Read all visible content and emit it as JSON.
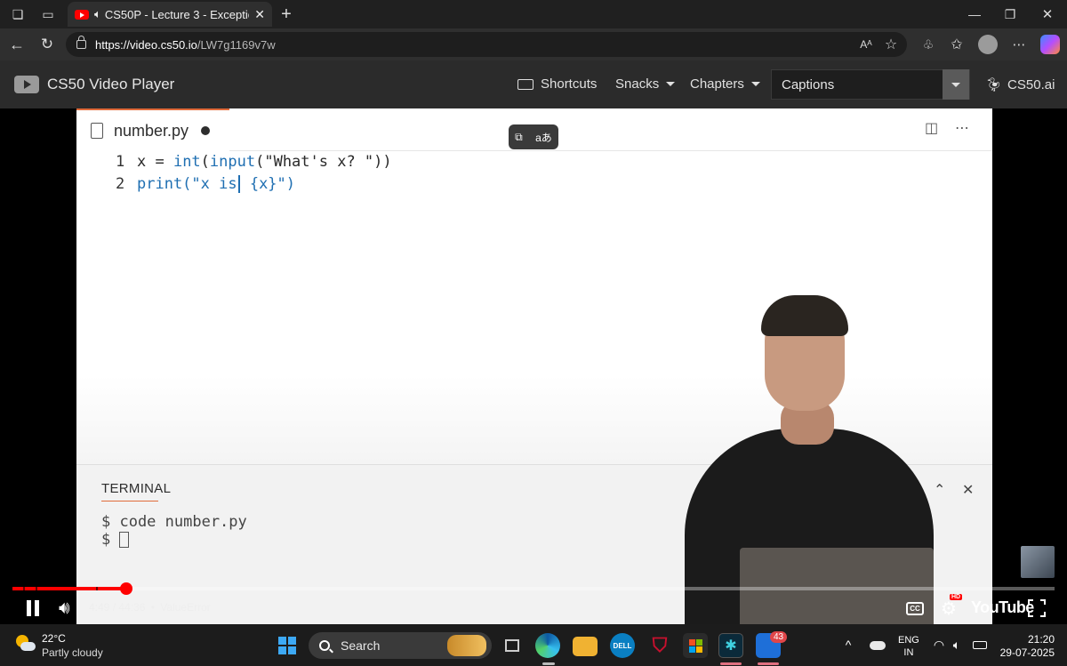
{
  "browser": {
    "tab_title": "CS50P - Lecture 3 - Exceptio",
    "url_domain": "https://video.cs50.io",
    "url_path": "/LW7g1169v7w"
  },
  "cs50": {
    "brand": "CS50 Video Player",
    "nav": {
      "shortcuts": "Shortcuts",
      "snacks": "Snacks",
      "chapters": "Chapters",
      "captions": "Captions",
      "cs50ai": "CS50.ai"
    }
  },
  "editor": {
    "filename": "number.py",
    "lines": [
      {
        "n": "1",
        "parts": [
          "x = ",
          "int",
          "(",
          "input",
          "(\"What's x? \"))"
        ]
      },
      {
        "n": "2",
        "before": "print(\"x is",
        "after": " {x}\")"
      }
    ],
    "terminal_title": "TERMINAL",
    "terminal_lines": [
      "$ code number.py",
      "$ "
    ]
  },
  "player": {
    "time": "4:49 / 44:36",
    "separator": "•",
    "chapter": "ValueError",
    "progress": 0.1093,
    "youtube_label": "YouTube",
    "cc_label": "CC",
    "hd_label": "HD"
  },
  "taskbar": {
    "weather_temp": "22°C",
    "weather_desc": "Partly cloudy",
    "search_placeholder": "Search",
    "notification_count": "43",
    "lang_top": "ENG",
    "lang_bottom": "IN",
    "time": "21:20",
    "date": "29-07-2025"
  },
  "colors": {
    "progress_red": "#ff0000",
    "editor_accent": "#e06b3a",
    "code_blue": "#1f6fb2"
  }
}
